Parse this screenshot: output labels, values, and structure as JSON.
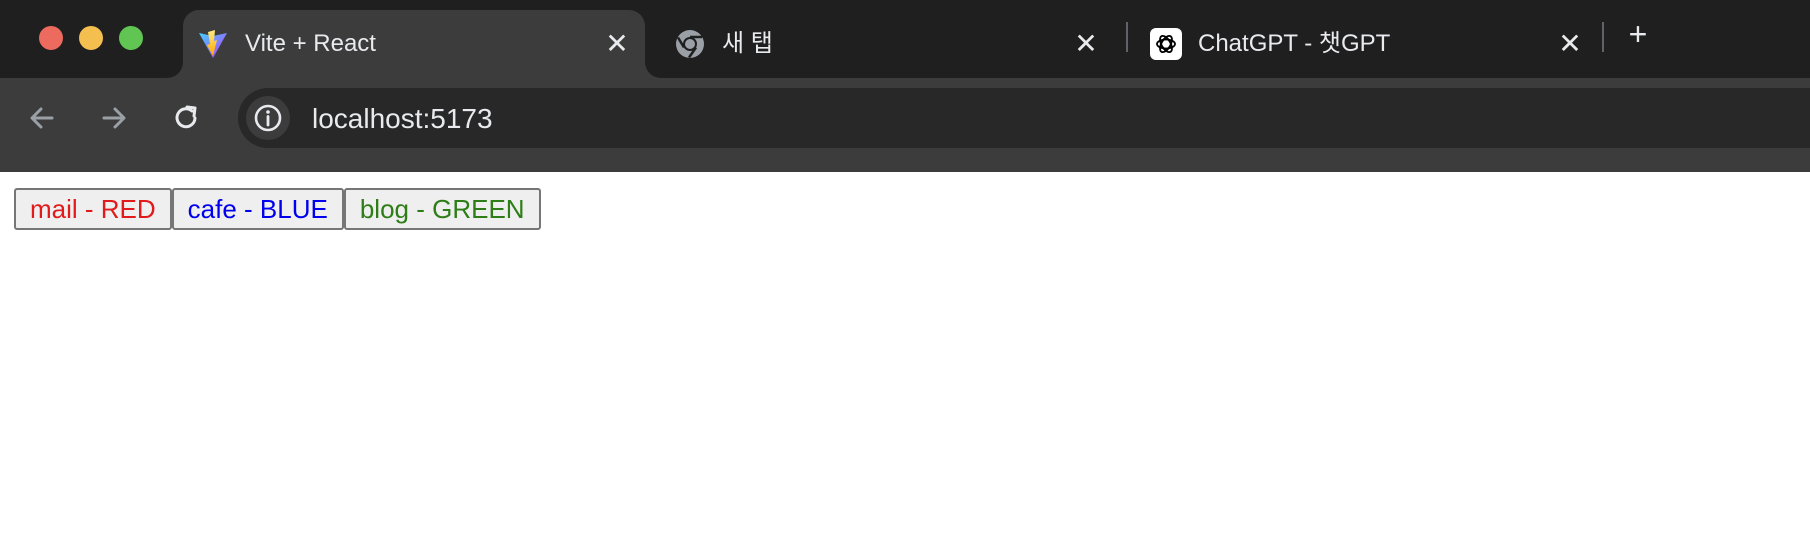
{
  "browser": {
    "tabs": [
      {
        "title": "Vite + React",
        "icon": "vite-icon",
        "active": true
      },
      {
        "title": "새 탭",
        "icon": "chrome-icon",
        "active": false
      },
      {
        "title": "ChatGPT - 챗GPT",
        "icon": "chatgpt-icon",
        "active": false
      }
    ],
    "tab_close_glyph": "✕",
    "new_tab_glyph": "+",
    "address": "localhost:5173"
  },
  "page": {
    "buttons": [
      {
        "label": "mail - RED",
        "color": "#e11b1b"
      },
      {
        "label": "cafe - BLUE",
        "color": "#0000ee"
      },
      {
        "label": "blog - GREEN",
        "color": "#2e7d17"
      }
    ]
  }
}
